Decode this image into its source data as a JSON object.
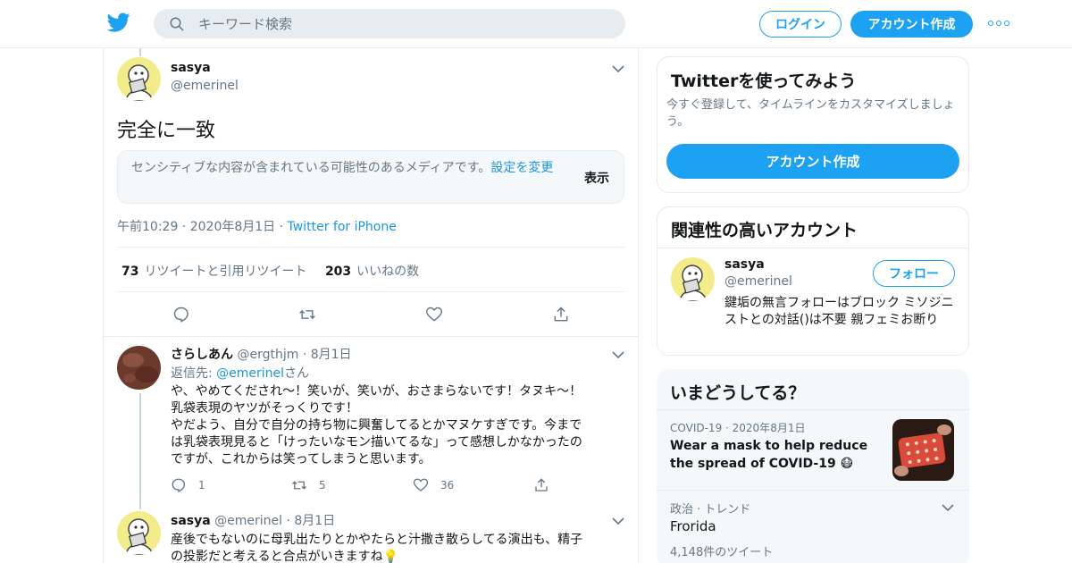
{
  "header": {
    "search_placeholder": "キーワード検索",
    "login_label": "ログイン",
    "signup_label": "アカウント作成",
    "accent_color": "#1da1f2"
  },
  "main_tweet": {
    "name": "sasya",
    "handle": "@emerinel",
    "text": "完全に一致",
    "sensitive_notice": "センシティブな内容が含まれている可能性のあるメディアです。",
    "sensitive_link": "設定を変更",
    "show_label": "表示",
    "time": "午前10:29",
    "date": "2020年8月1日",
    "via": "Twitter for iPhone",
    "retweet_count": "73",
    "retweet_label": "リツイートと引用リツイート",
    "like_count": "203",
    "like_label": "いいねの数"
  },
  "replies": [
    {
      "name": "さらしあん",
      "handle": "@ergthjm",
      "date": "8月1日",
      "reply_to_prefix": "返信先: ",
      "reply_to_handle": "@emerinel",
      "reply_to_suffix": "さん",
      "lines": [
        "や、やめてくだされ〜！笑いが、笑いが、おさまらないです！タヌキ〜！",
        "乳袋表現のヤツがそっくりです！",
        "やだよう、自分で自分の持ち物に興奮してるとかマヌケすぎです。今まで",
        "は乳袋表現見ると「けったいなモン描いてるな」って感想しかなかったの",
        "ですが、これからは笑ってしまうと思います。"
      ],
      "reply_count": "1",
      "retweet_count": "5",
      "like_count": "36"
    },
    {
      "name": "sasya",
      "handle": "@emerinel",
      "date": "8月1日",
      "lines": [
        "産後でもないのに母乳出たりとかやたらと汁撒き散らしてる演出も、精子",
        "の投影だと考えると合点がいきますね💡"
      ]
    }
  ],
  "signup_card": {
    "title": "Twitterを使ってみよう",
    "description": "今すぐ登録して、タイムラインをカスタマイズしましょう。",
    "button_label": "アカウント作成"
  },
  "related_card": {
    "title": "関連性の高いアカウント",
    "name": "sasya",
    "handle": "@emerinel",
    "follow_label": "フォロー",
    "bio": "鍵垢の無言フォローはブロック ミソジニストとの対話()は不要 親フェミお断り"
  },
  "trends_card": {
    "title": "いまどうしてる？",
    "news": {
      "category": "COVID-19",
      "date": "2020年8月1日",
      "headline": "Wear a mask to help reduce the spread of COVID-19 😷"
    },
    "trend": {
      "context": "政治 · トレンド",
      "name": "Frorida",
      "count": "4,148件のツイート"
    }
  }
}
